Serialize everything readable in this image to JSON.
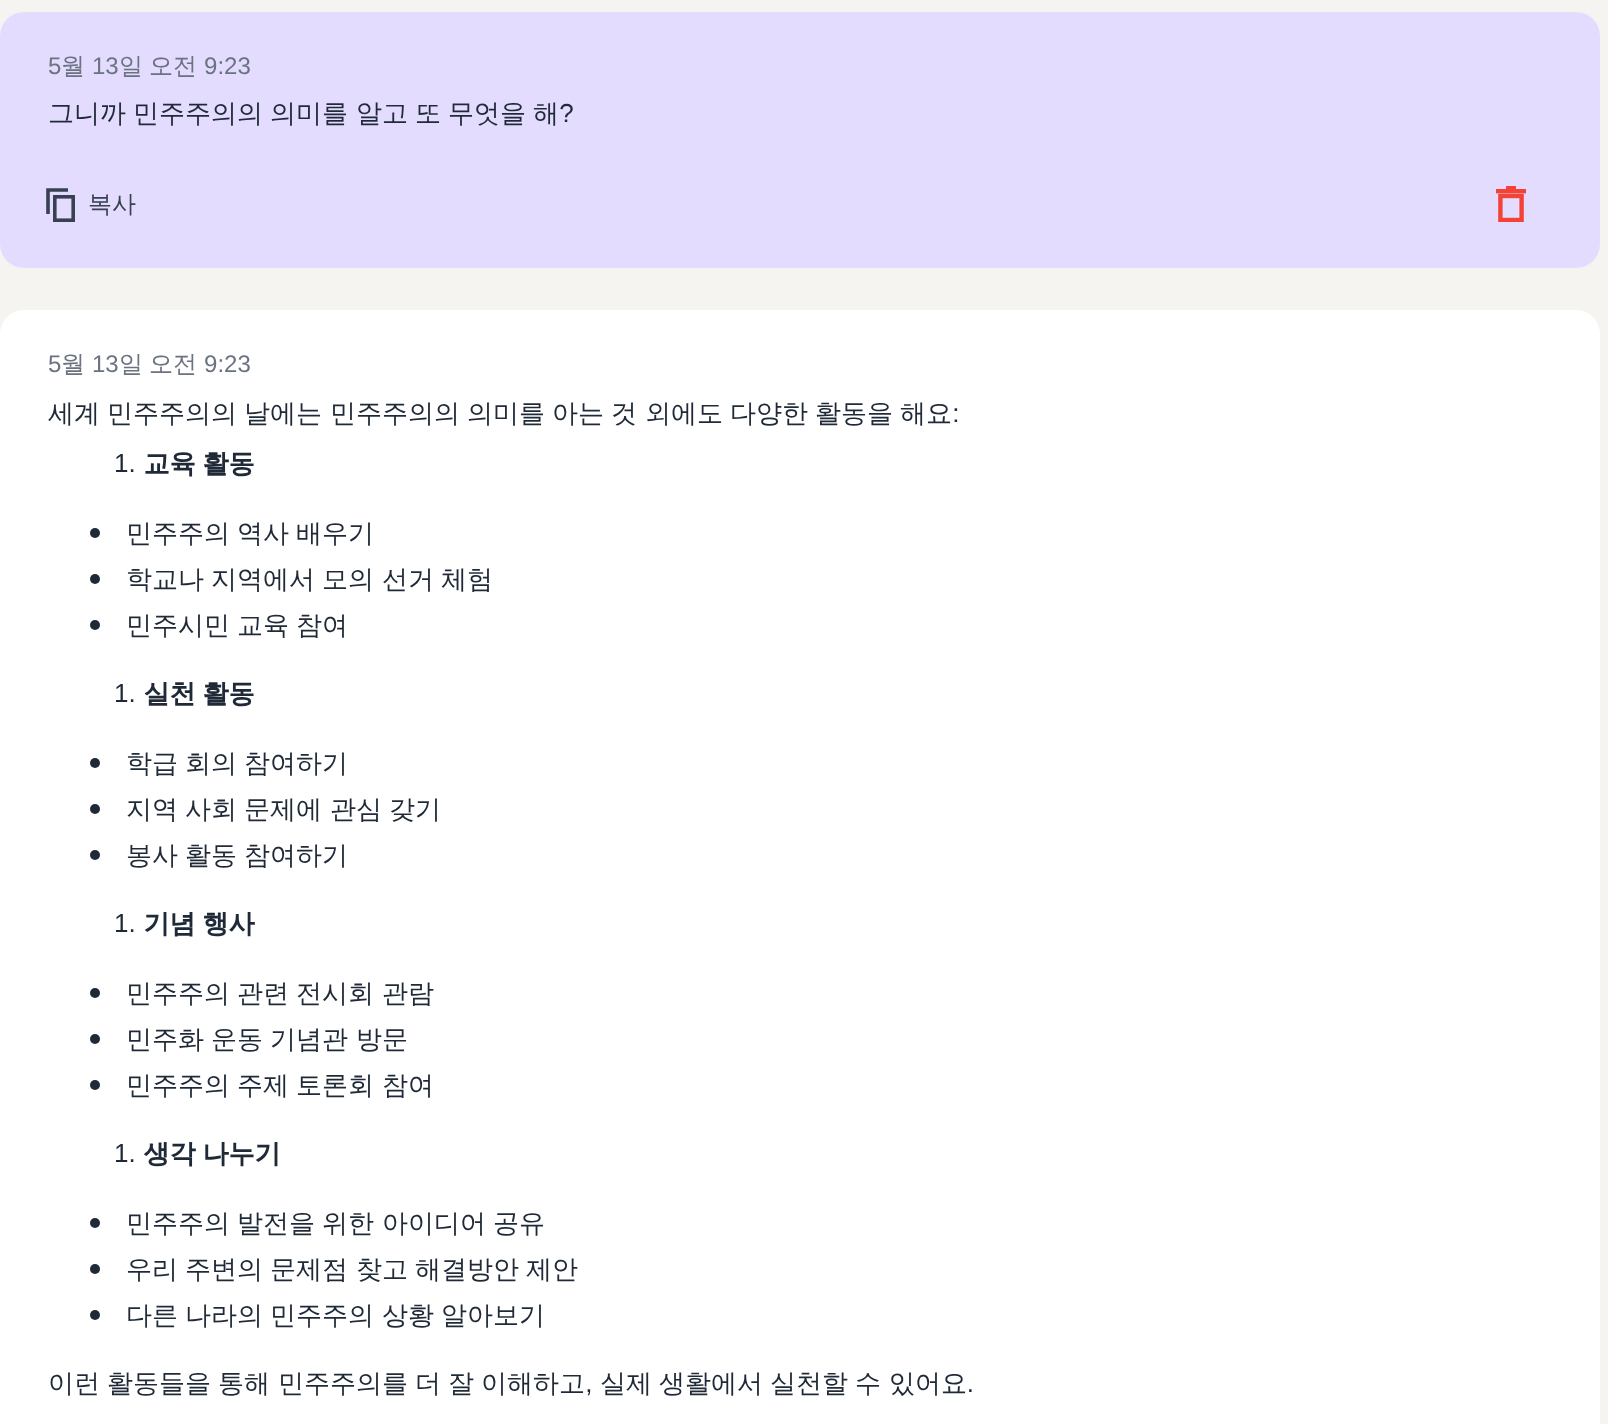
{
  "question_card": {
    "timestamp": "5월 13일 오전 9:23",
    "text": "그니까 민주주의의 의미를 알고 또 무엇을 해?",
    "copy_label": "복사"
  },
  "answer_card": {
    "timestamp": "5월 13일 오전 9:23",
    "intro": "세계 민주주의의 날에는 민주주의의 의미를 아는 것 외에도 다양한 활동을 해요:",
    "sections": [
      {
        "number": "1.",
        "title": "교육 활동",
        "items": [
          "민주주의 역사 배우기",
          "학교나 지역에서 모의 선거 체험",
          "민주시민 교육 참여"
        ]
      },
      {
        "number": "1.",
        "title": "실천 활동",
        "items": [
          "학급 회의 참여하기",
          "지역 사회 문제에 관심 갖기",
          "봉사 활동 참여하기"
        ]
      },
      {
        "number": "1.",
        "title": "기념 행사",
        "items": [
          "민주주의 관련 전시회 관람",
          "민주화 운동 기념관 방문",
          "민주주의 주제 토론회 참여"
        ]
      },
      {
        "number": "1.",
        "title": "생각 나누기",
        "items": [
          "민주주의 발전을 위한 아이디어 공유",
          "우리 주변의 문제점 찾고 해결방안 제안",
          "다른 나라의 민주주의 상황 알아보기"
        ]
      }
    ],
    "outro": "이런 활동들을 통해 민주주의를 더 잘 이해하고, 실제 생활에서 실천할 수 있어요."
  }
}
